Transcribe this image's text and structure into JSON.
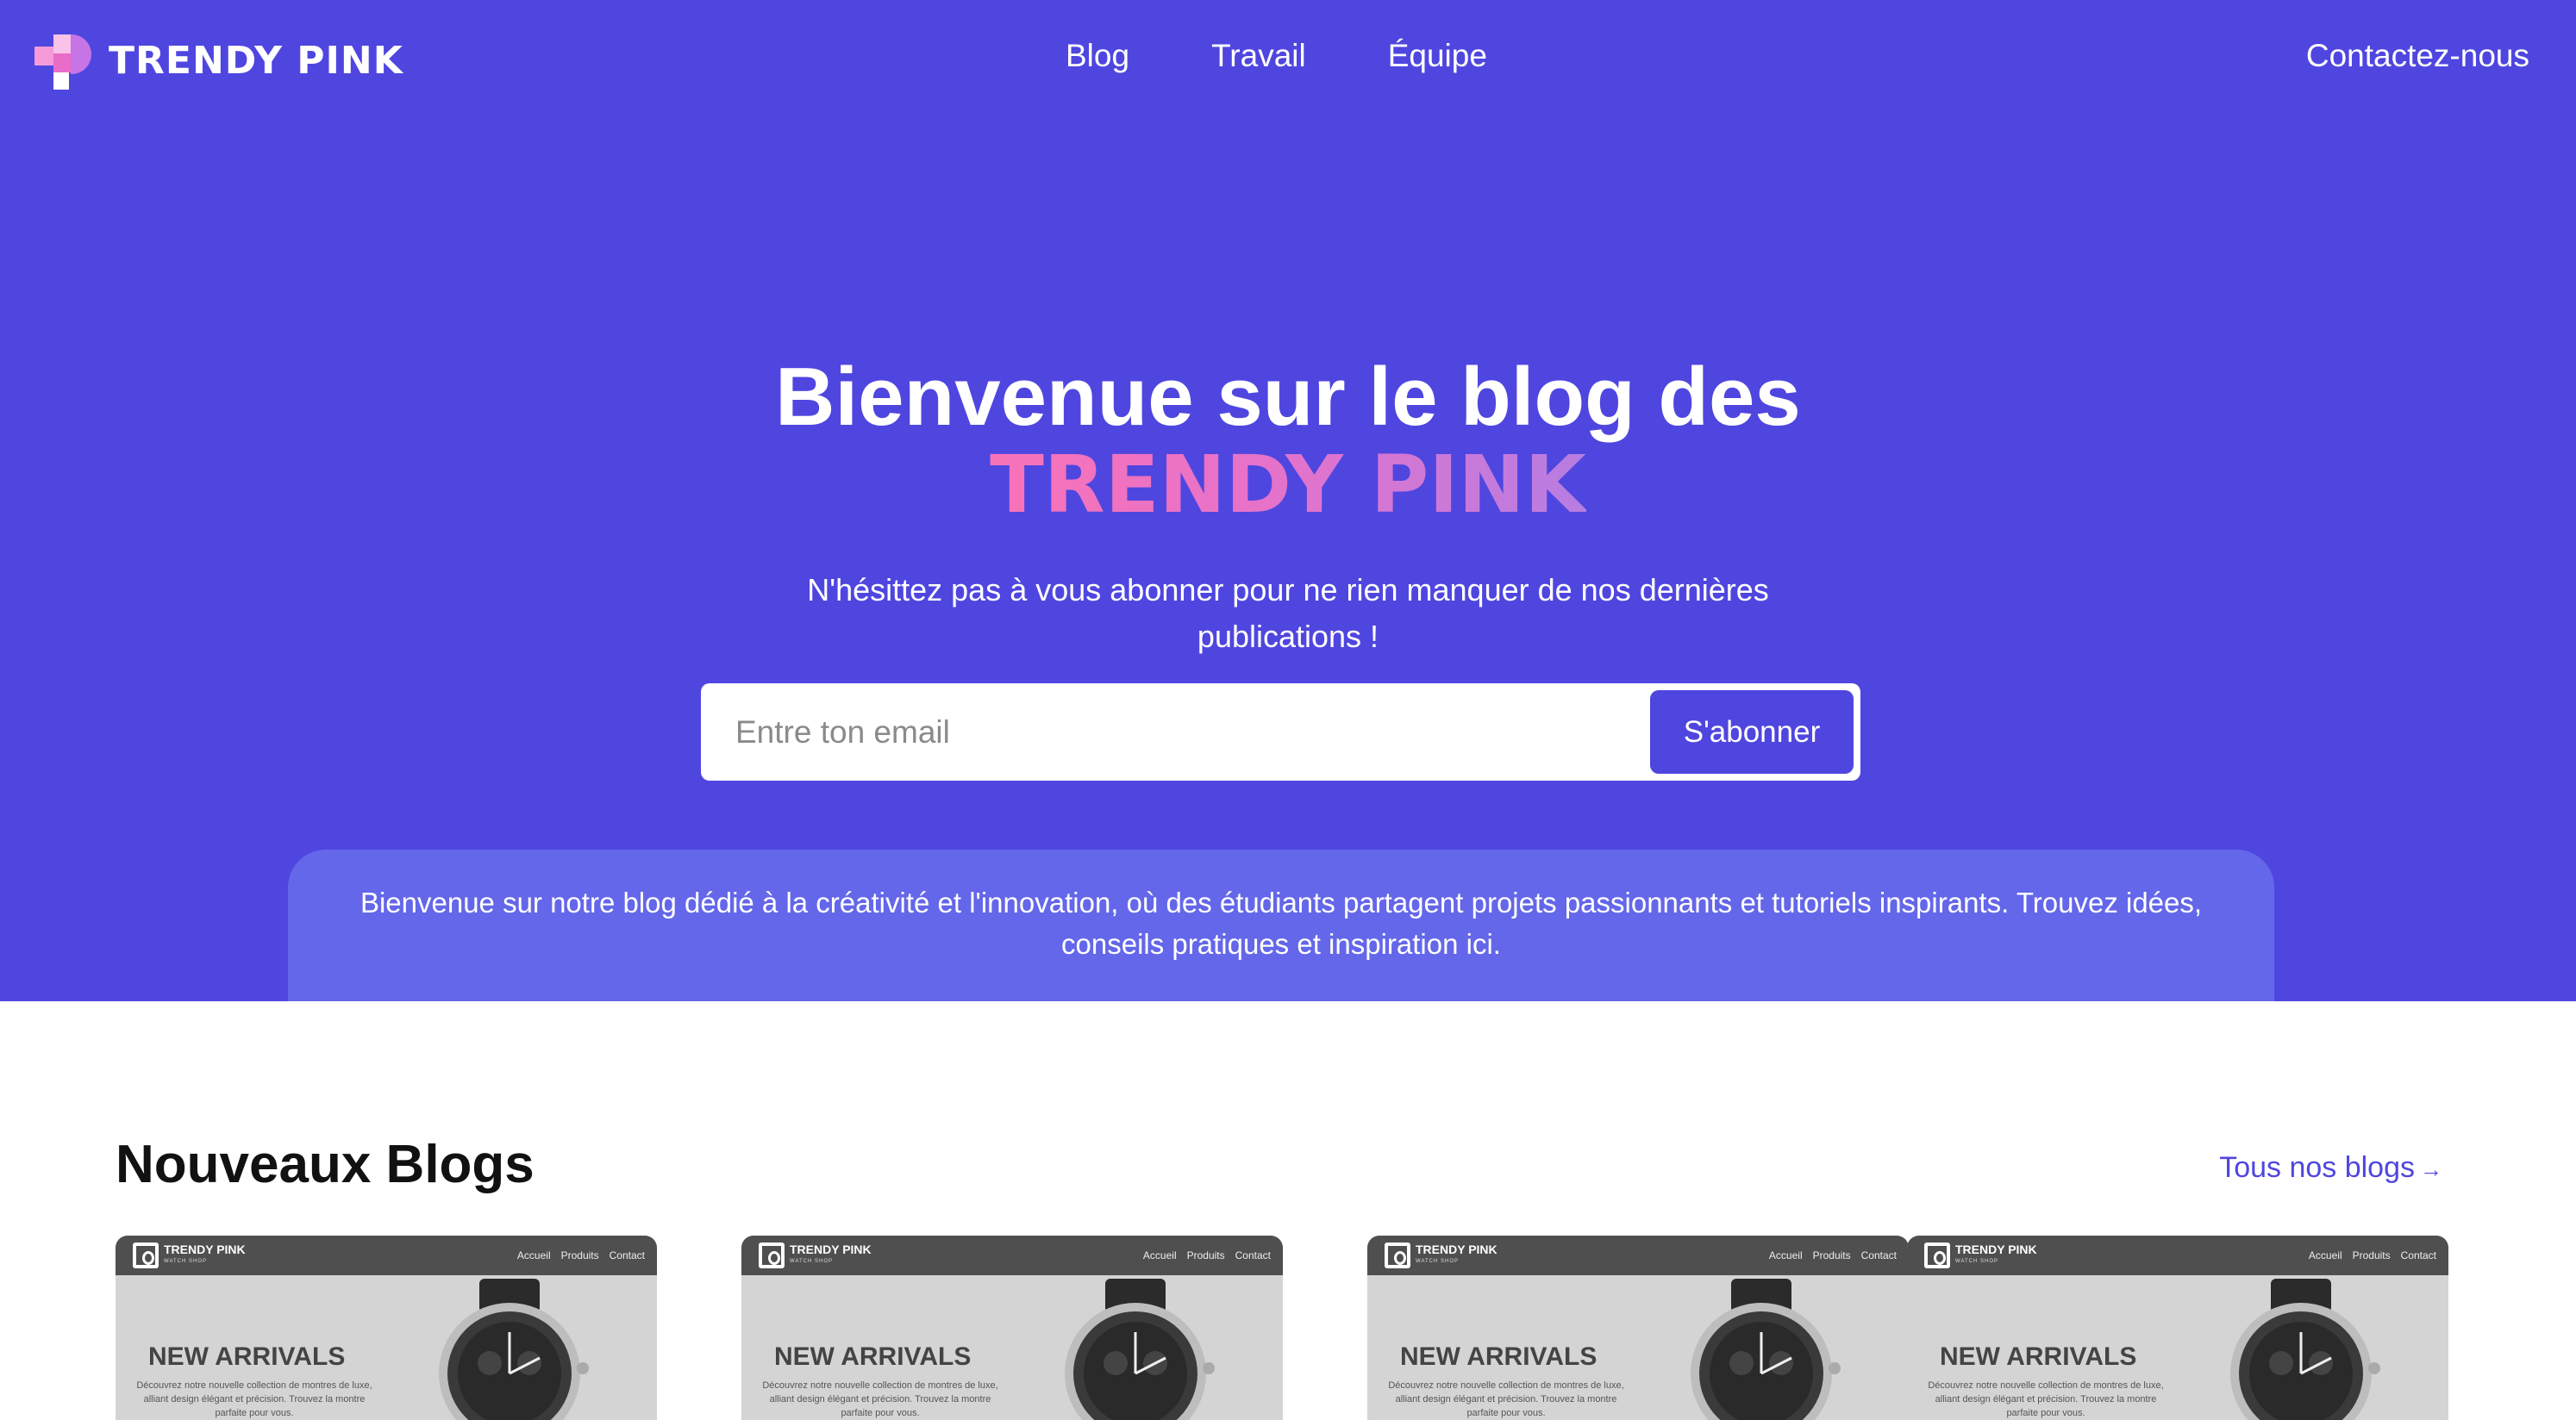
{
  "brand": {
    "name": "TRENDY PINK"
  },
  "nav": {
    "links": [
      "Blog",
      "Travail",
      "Équipe"
    ],
    "contact": "Contactez-nous"
  },
  "hero": {
    "title_line1": "Bienvenue sur le blog des",
    "title_line2": "TRENDY PINK",
    "subtitle": "N'hésittez pas à vous abonner pour ne rien manquer de nos dernières publications !",
    "email_placeholder": "Entre ton email",
    "subscribe_label": "S'abonner",
    "intro": "Bienvenue sur notre blog dédié à la créativité et l'innovation, où des étudiants partagent projets passionnants et tutoriels inspirants. Trouvez idées, conseils pratiques et inspiration ici."
  },
  "section": {
    "title": "Nouveaux Blogs",
    "all_link": "Tous nos blogs",
    "all_link_arrow": "→"
  },
  "cards": [
    {
      "brand": "TRENDY PINK",
      "tagline": "WATCH SHOP",
      "menu": [
        "Accueil",
        "Produits",
        "Contact"
      ],
      "heading": "NEW ARRIVALS",
      "desc": "Découvrez notre nouvelle collection de montres de luxe, alliant design élégant et précision. Trouvez la montre parfaite pour vous."
    },
    {
      "brand": "TRENDY PINK",
      "tagline": "WATCH SHOP",
      "menu": [
        "Accueil",
        "Produits",
        "Contact"
      ],
      "heading": "NEW ARRIVALS",
      "desc": "Découvrez notre nouvelle collection de montres de luxe, alliant design élégant et précision. Trouvez la montre parfaite pour vous."
    },
    {
      "brand": "TRENDY PINK",
      "tagline": "WATCH SHOP",
      "menu": [
        "Accueil",
        "Produits",
        "Contact"
      ],
      "heading": "NEW ARRIVALS",
      "desc": "Découvrez notre nouvelle collection de montres de luxe, alliant design élégant et précision. Trouvez la montre parfaite pour vous."
    },
    {
      "brand": "TRENDY PINK",
      "tagline": "WATCH SHOP",
      "menu": [
        "Accueil",
        "Produits",
        "Contact"
      ],
      "heading": "NEW ARRIVALS",
      "desc": "Découvrez notre nouvelle collection de montres de luxe, alliant design élégant et précision. Trouvez la montre parfaite pour vous."
    }
  ],
  "colors": {
    "primary": "#4f46e0",
    "intro_box": "#6467e9",
    "accent_pink": "#f873b8",
    "accent_purple": "#b77de2"
  }
}
